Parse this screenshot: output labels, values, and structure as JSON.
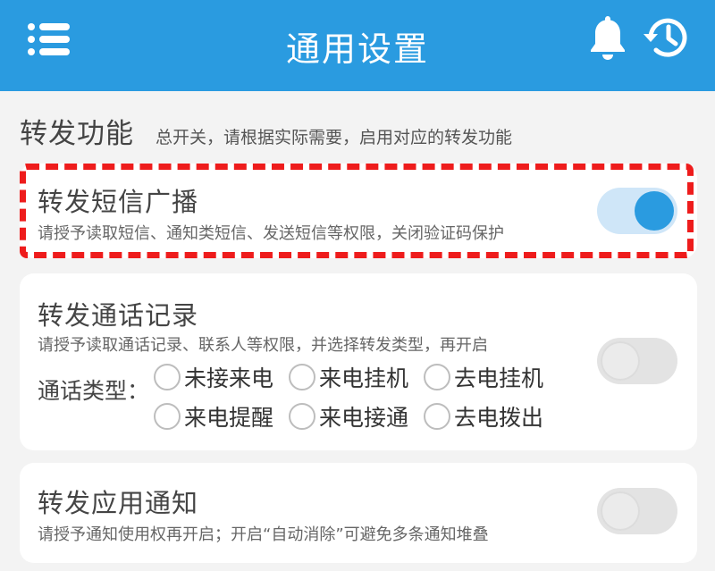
{
  "appbar": {
    "title": "通用设置",
    "menu_icon": "menu-icon",
    "bell_icon": "bell-icon",
    "history_icon": "history-icon"
  },
  "section": {
    "title": "转发功能",
    "subtitle": "总开关，请根据实际需要，启用对应的转发功能"
  },
  "cards": {
    "sms": {
      "title": "转发短信广播",
      "desc": "请授予读取短信、通知类短信、发送短信等权限，关闭验证码保护",
      "enabled": true
    },
    "call": {
      "title": "转发通话记录",
      "desc": "请授予读取通话记录、联系人等权限，并选择转发类型，再开启",
      "enabled": false,
      "type_label": "通话类型：",
      "options": [
        "未接来电",
        "来电挂机",
        "去电挂机",
        "来电提醒",
        "来电接通",
        "去电拨出"
      ]
    },
    "app": {
      "title": "转发应用通知",
      "desc": "请授予通知使用权再开启；开启“自动消除”可避免多条通知堆叠",
      "enabled": false
    }
  },
  "colors": {
    "primary": "#2a9be0",
    "highlight": "#ee1c1c",
    "background": "#f3f3f3"
  }
}
